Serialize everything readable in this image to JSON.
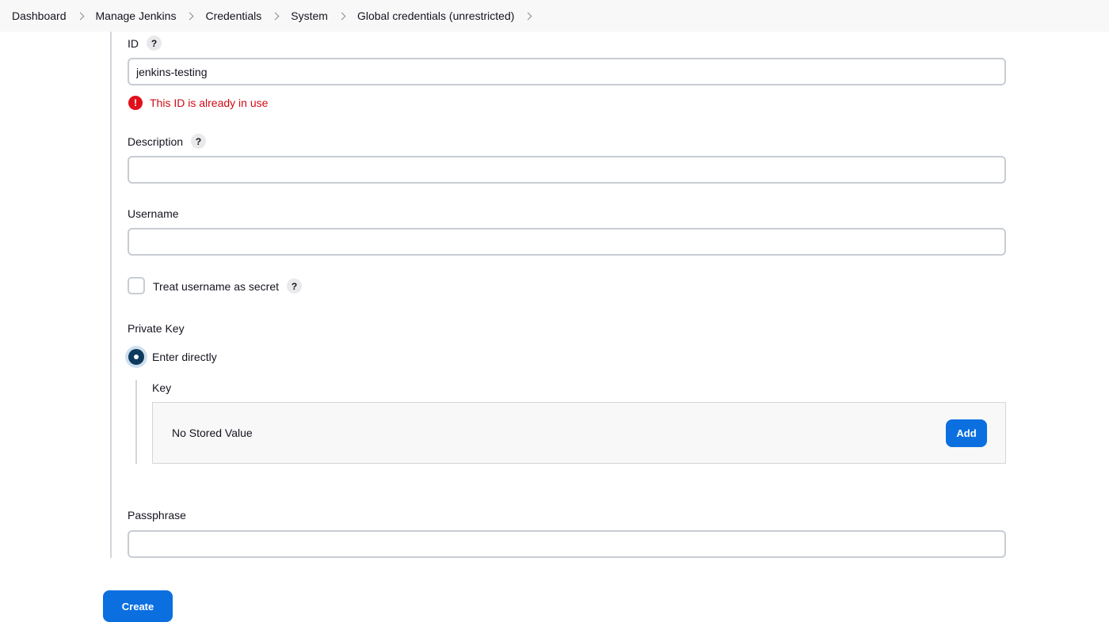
{
  "breadcrumb": [
    "Dashboard",
    "Manage Jenkins",
    "Credentials",
    "System",
    "Global credentials (unrestricted)"
  ],
  "form": {
    "id": {
      "label": "ID",
      "help": "?",
      "value": "jenkins-testing",
      "error": "This ID is already in use",
      "error_icon": "!"
    },
    "description": {
      "label": "Description",
      "help": "?",
      "value": ""
    },
    "username": {
      "label": "Username",
      "value": ""
    },
    "treat_secret": {
      "label": "Treat username as secret",
      "help": "?",
      "checked": false
    },
    "private_key": {
      "label": "Private Key",
      "option_label": "Enter directly",
      "selected": true,
      "key_label": "Key",
      "no_value": "No Stored Value",
      "add_label": "Add"
    },
    "passphrase": {
      "label": "Passphrase",
      "value": ""
    },
    "create_label": "Create"
  },
  "colors": {
    "primary": "#0b6fe0",
    "error": "#d00a14",
    "radio": "#0e3a5e"
  }
}
